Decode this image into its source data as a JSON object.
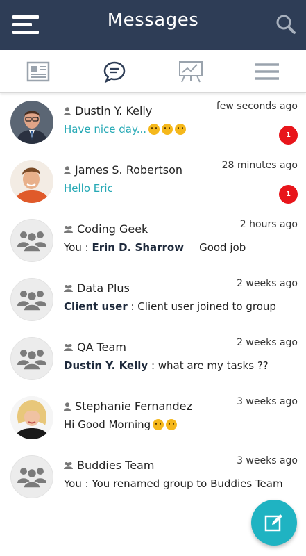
{
  "header": {
    "title": "Messages",
    "menu_icon": "hamburger-menu-icon",
    "search_icon": "search-icon"
  },
  "tabs": [
    {
      "icon": "newspaper-icon"
    },
    {
      "icon": "chat-bubble-icon",
      "active": true
    },
    {
      "icon": "presentation-chart-icon"
    },
    {
      "icon": "menu-lines-icon"
    }
  ],
  "colors": {
    "header_bg": "#2e3d56",
    "accent": "#1fb3c2",
    "unread_text": "#26a9b5",
    "badge": "#e8151b"
  },
  "conversations": [
    {
      "name": "Dustin Y. Kelly",
      "type": "user",
      "time": "few seconds ago",
      "message": "Have nice day...",
      "emojis": 3,
      "unread": true,
      "badge": "1"
    },
    {
      "name": "James S. Robertson",
      "type": "user",
      "time": "28 minutes ago",
      "message": "Hello Eric",
      "unread": true,
      "badge": "1"
    },
    {
      "name": "Coding Geek",
      "type": "group",
      "time": "2 hours ago",
      "sender_prefix": "You : ",
      "sender": "Erin D. Sharrow",
      "message": "Good job"
    },
    {
      "name": "Data Plus",
      "type": "group",
      "time": "2 weeks ago",
      "sender": "Client user",
      "message": " : Client user joined to group"
    },
    {
      "name": "QA Team",
      "type": "group",
      "time": "2 weeks ago",
      "sender": "Dustin Y. Kelly",
      "message": " : what are my tasks ??"
    },
    {
      "name": "Stephanie Fernandez",
      "type": "user",
      "time": "3 weeks ago",
      "message": "Hi Good Morning",
      "emojis": 2
    },
    {
      "name": "Buddies Team",
      "type": "group",
      "time": "3 weeks ago",
      "message": "You : You renamed group to Buddies Team"
    }
  ],
  "fab": {
    "icon": "compose-icon"
  }
}
